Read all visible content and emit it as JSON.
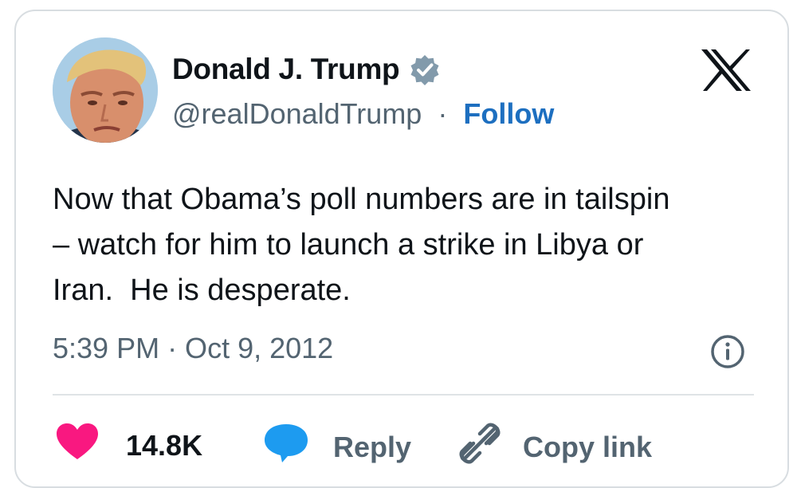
{
  "author": {
    "name": "Donald J. Trump",
    "handle": "@realDonaldTrump",
    "separator": "·",
    "follow_label": "Follow",
    "verified": true
  },
  "brand": {
    "logo_icon": "x-logo-icon"
  },
  "tweet": {
    "text": "Now that Obama’s poll numbers are in tailspin\n– watch for him to launch a strike in Libya or\nIran.  He is desperate.",
    "timestamp": "5:39 PM · Oct 9, 2012"
  },
  "actions": {
    "like_count": "14.8K",
    "reply_label": "Reply",
    "copy_link_label": "Copy link"
  },
  "colors": {
    "like": "#f91880",
    "reply_bubble": "#1d9bf0",
    "follow": "#1d6fc0",
    "verified_badge": "#829aab",
    "text": "#0f1419",
    "secondary_text": "#536471"
  }
}
